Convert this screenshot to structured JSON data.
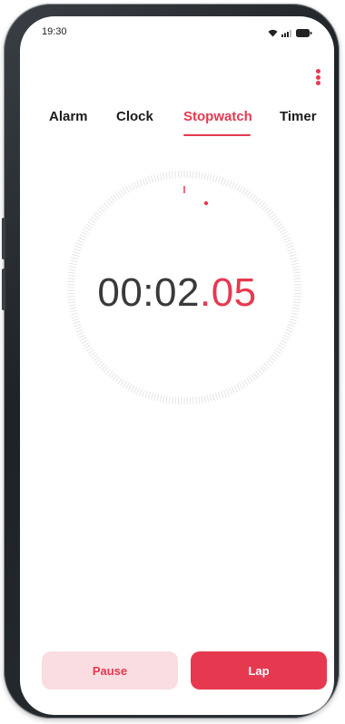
{
  "status_bar": {
    "time": "19:30"
  },
  "tabs": [
    {
      "label": "Alarm",
      "active": false
    },
    {
      "label": "Clock",
      "active": false
    },
    {
      "label": "Stopwatch",
      "active": true
    },
    {
      "label": "Timer",
      "active": false
    }
  ],
  "stopwatch": {
    "main": "00:02",
    "hundredths": ".05"
  },
  "buttons": {
    "pause": "Pause",
    "lap": "Lap"
  },
  "colors": {
    "accent": "#e63950",
    "pause_bg": "#f9dde1"
  },
  "icons": [
    "wifi-icon",
    "signal-icon",
    "battery-icon",
    "more-options-icon"
  ]
}
